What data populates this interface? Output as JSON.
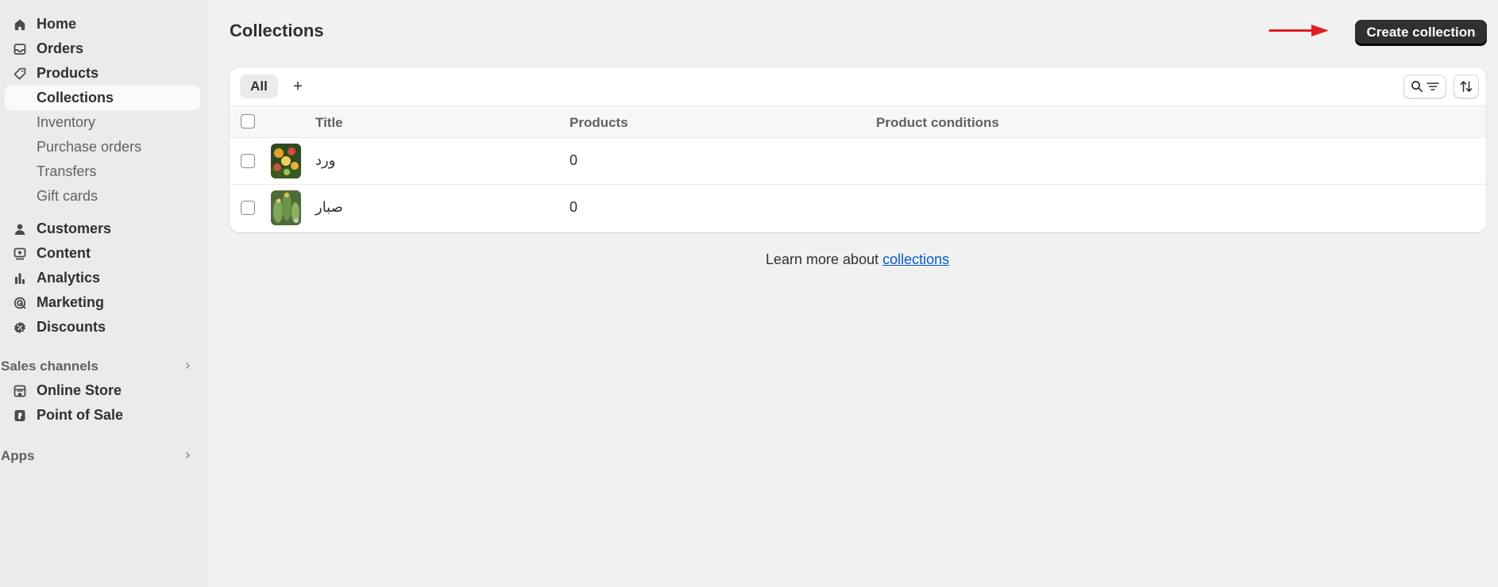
{
  "sidebar": {
    "items": [
      {
        "label": "Home",
        "icon": "home-icon"
      },
      {
        "label": "Orders",
        "icon": "inbox-icon"
      },
      {
        "label": "Products",
        "icon": "tag-icon"
      },
      {
        "label": "Collections"
      },
      {
        "label": "Inventory"
      },
      {
        "label": "Purchase orders"
      },
      {
        "label": "Transfers"
      },
      {
        "label": "Gift cards"
      },
      {
        "label": "Customers",
        "icon": "person-icon"
      },
      {
        "label": "Content",
        "icon": "content-icon"
      },
      {
        "label": "Analytics",
        "icon": "bar-chart-icon"
      },
      {
        "label": "Marketing",
        "icon": "target-icon"
      },
      {
        "label": "Discounts",
        "icon": "discount-icon"
      }
    ],
    "sales_channels_label": "Sales channels",
    "sales_channels": [
      {
        "label": "Online Store",
        "icon": "store-icon"
      },
      {
        "label": "Point of Sale",
        "icon": "pos-icon"
      }
    ],
    "apps_label": "Apps"
  },
  "header": {
    "title": "Collections",
    "create_label": "Create collection"
  },
  "tabs": {
    "all_label": "All",
    "add_label": "+"
  },
  "table": {
    "columns": [
      "Title",
      "Products",
      "Product conditions"
    ],
    "rows": [
      {
        "title": "ورد",
        "products": "0",
        "conditions": ""
      },
      {
        "title": "صبار",
        "products": "0",
        "conditions": ""
      }
    ]
  },
  "footer": {
    "learn_prefix": "Learn more about ",
    "learn_link": "collections"
  },
  "colors": {
    "primary_button": "#303030",
    "link": "#005bd3",
    "annotation_arrow": "#e02020"
  }
}
